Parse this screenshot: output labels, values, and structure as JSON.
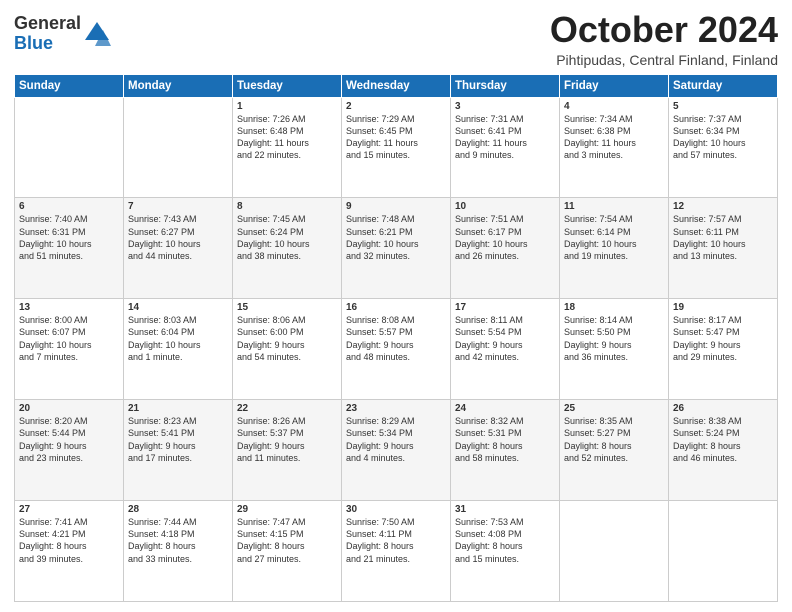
{
  "header": {
    "logo_general": "General",
    "logo_blue": "Blue",
    "month_title": "October 2024",
    "location": "Pihtipudas, Central Finland, Finland"
  },
  "days_of_week": [
    "Sunday",
    "Monday",
    "Tuesday",
    "Wednesday",
    "Thursday",
    "Friday",
    "Saturday"
  ],
  "weeks": [
    [
      {
        "day": "",
        "content": ""
      },
      {
        "day": "",
        "content": ""
      },
      {
        "day": "1",
        "content": "Sunrise: 7:26 AM\nSunset: 6:48 PM\nDaylight: 11 hours\nand 22 minutes."
      },
      {
        "day": "2",
        "content": "Sunrise: 7:29 AM\nSunset: 6:45 PM\nDaylight: 11 hours\nand 15 minutes."
      },
      {
        "day": "3",
        "content": "Sunrise: 7:31 AM\nSunset: 6:41 PM\nDaylight: 11 hours\nand 9 minutes."
      },
      {
        "day": "4",
        "content": "Sunrise: 7:34 AM\nSunset: 6:38 PM\nDaylight: 11 hours\nand 3 minutes."
      },
      {
        "day": "5",
        "content": "Sunrise: 7:37 AM\nSunset: 6:34 PM\nDaylight: 10 hours\nand 57 minutes."
      }
    ],
    [
      {
        "day": "6",
        "content": "Sunrise: 7:40 AM\nSunset: 6:31 PM\nDaylight: 10 hours\nand 51 minutes."
      },
      {
        "day": "7",
        "content": "Sunrise: 7:43 AM\nSunset: 6:27 PM\nDaylight: 10 hours\nand 44 minutes."
      },
      {
        "day": "8",
        "content": "Sunrise: 7:45 AM\nSunset: 6:24 PM\nDaylight: 10 hours\nand 38 minutes."
      },
      {
        "day": "9",
        "content": "Sunrise: 7:48 AM\nSunset: 6:21 PM\nDaylight: 10 hours\nand 32 minutes."
      },
      {
        "day": "10",
        "content": "Sunrise: 7:51 AM\nSunset: 6:17 PM\nDaylight: 10 hours\nand 26 minutes."
      },
      {
        "day": "11",
        "content": "Sunrise: 7:54 AM\nSunset: 6:14 PM\nDaylight: 10 hours\nand 19 minutes."
      },
      {
        "day": "12",
        "content": "Sunrise: 7:57 AM\nSunset: 6:11 PM\nDaylight: 10 hours\nand 13 minutes."
      }
    ],
    [
      {
        "day": "13",
        "content": "Sunrise: 8:00 AM\nSunset: 6:07 PM\nDaylight: 10 hours\nand 7 minutes."
      },
      {
        "day": "14",
        "content": "Sunrise: 8:03 AM\nSunset: 6:04 PM\nDaylight: 10 hours\nand 1 minute."
      },
      {
        "day": "15",
        "content": "Sunrise: 8:06 AM\nSunset: 6:00 PM\nDaylight: 9 hours\nand 54 minutes."
      },
      {
        "day": "16",
        "content": "Sunrise: 8:08 AM\nSunset: 5:57 PM\nDaylight: 9 hours\nand 48 minutes."
      },
      {
        "day": "17",
        "content": "Sunrise: 8:11 AM\nSunset: 5:54 PM\nDaylight: 9 hours\nand 42 minutes."
      },
      {
        "day": "18",
        "content": "Sunrise: 8:14 AM\nSunset: 5:50 PM\nDaylight: 9 hours\nand 36 minutes."
      },
      {
        "day": "19",
        "content": "Sunrise: 8:17 AM\nSunset: 5:47 PM\nDaylight: 9 hours\nand 29 minutes."
      }
    ],
    [
      {
        "day": "20",
        "content": "Sunrise: 8:20 AM\nSunset: 5:44 PM\nDaylight: 9 hours\nand 23 minutes."
      },
      {
        "day": "21",
        "content": "Sunrise: 8:23 AM\nSunset: 5:41 PM\nDaylight: 9 hours\nand 17 minutes."
      },
      {
        "day": "22",
        "content": "Sunrise: 8:26 AM\nSunset: 5:37 PM\nDaylight: 9 hours\nand 11 minutes."
      },
      {
        "day": "23",
        "content": "Sunrise: 8:29 AM\nSunset: 5:34 PM\nDaylight: 9 hours\nand 4 minutes."
      },
      {
        "day": "24",
        "content": "Sunrise: 8:32 AM\nSunset: 5:31 PM\nDaylight: 8 hours\nand 58 minutes."
      },
      {
        "day": "25",
        "content": "Sunrise: 8:35 AM\nSunset: 5:27 PM\nDaylight: 8 hours\nand 52 minutes."
      },
      {
        "day": "26",
        "content": "Sunrise: 8:38 AM\nSunset: 5:24 PM\nDaylight: 8 hours\nand 46 minutes."
      }
    ],
    [
      {
        "day": "27",
        "content": "Sunrise: 7:41 AM\nSunset: 4:21 PM\nDaylight: 8 hours\nand 39 minutes."
      },
      {
        "day": "28",
        "content": "Sunrise: 7:44 AM\nSunset: 4:18 PM\nDaylight: 8 hours\nand 33 minutes."
      },
      {
        "day": "29",
        "content": "Sunrise: 7:47 AM\nSunset: 4:15 PM\nDaylight: 8 hours\nand 27 minutes."
      },
      {
        "day": "30",
        "content": "Sunrise: 7:50 AM\nSunset: 4:11 PM\nDaylight: 8 hours\nand 21 minutes."
      },
      {
        "day": "31",
        "content": "Sunrise: 7:53 AM\nSunset: 4:08 PM\nDaylight: 8 hours\nand 15 minutes."
      },
      {
        "day": "",
        "content": ""
      },
      {
        "day": "",
        "content": ""
      }
    ]
  ]
}
